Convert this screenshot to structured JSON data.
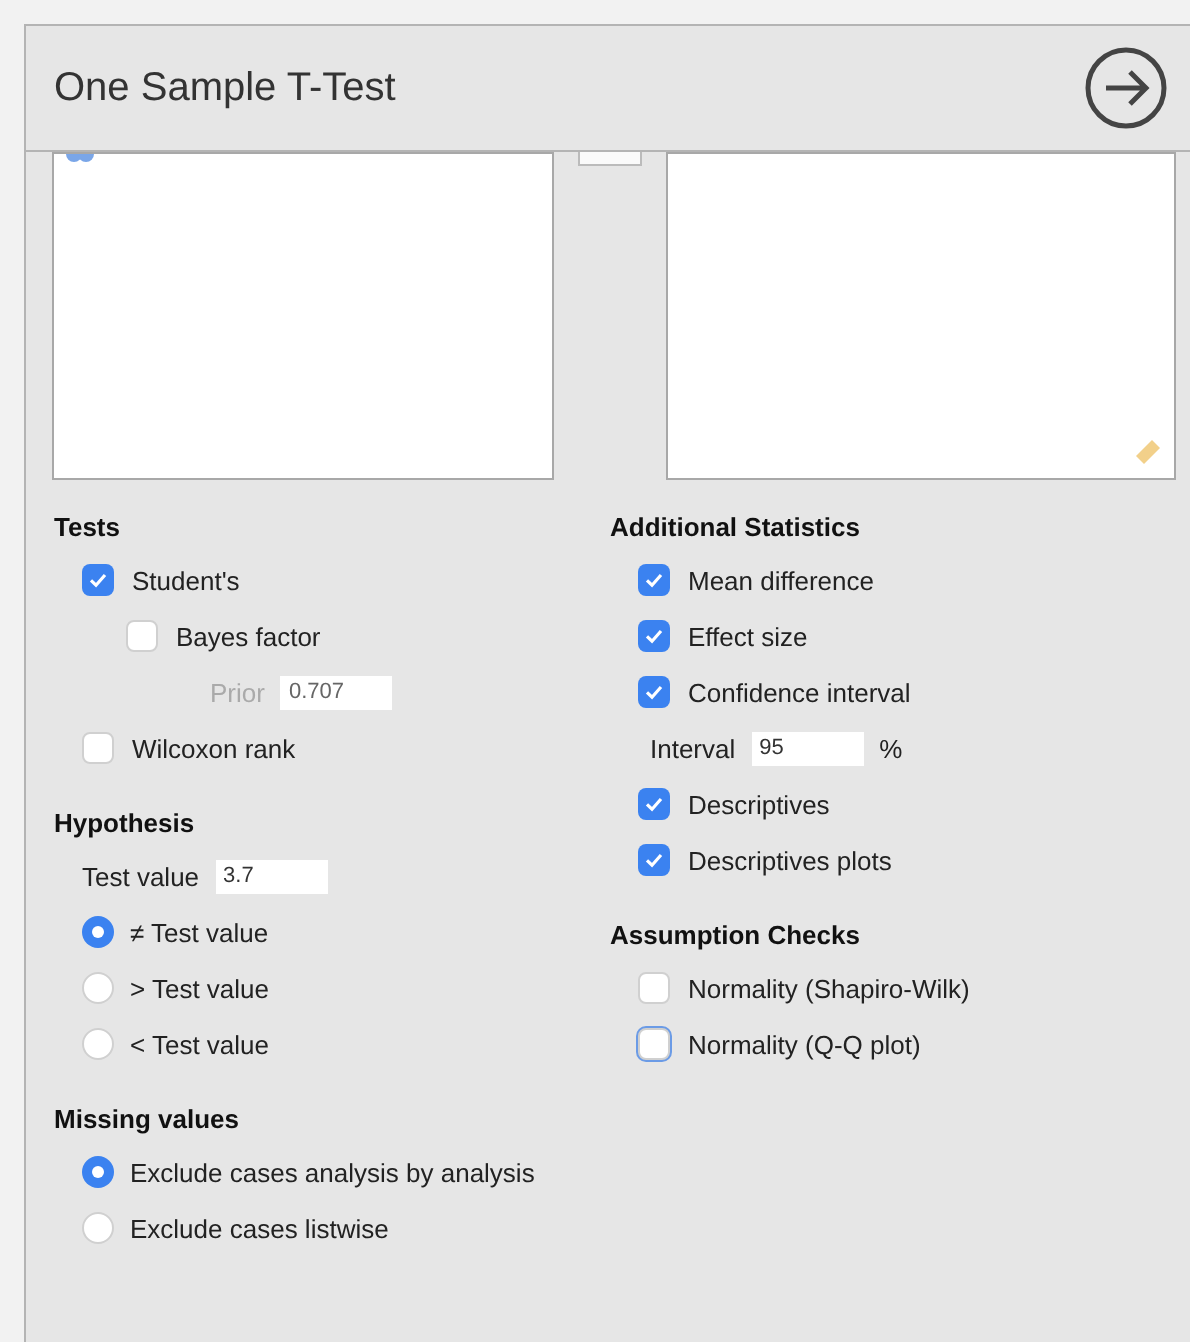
{
  "panel": {
    "title": "One Sample T-Test"
  },
  "left_column": [
    {
      "heading": "Tests",
      "items": [
        {
          "kind": "checkbox",
          "label": "Student's",
          "checked": true,
          "children": [
            {
              "kind": "checkbox",
              "label": "Bayes factor",
              "checked": false,
              "children": [
                {
                  "kind": "field",
                  "label": "Prior",
                  "value": "0.707",
                  "disabled": true
                }
              ]
            }
          ]
        },
        {
          "kind": "checkbox",
          "label": "Wilcoxon rank",
          "checked": false
        }
      ]
    },
    {
      "heading": "Hypothesis",
      "items": [
        {
          "kind": "field",
          "label": "Test value",
          "value": "3.7",
          "disabled": false
        },
        {
          "kind": "radio",
          "label": "≠ Test value",
          "selected": true
        },
        {
          "kind": "radio",
          "label": "> Test value",
          "selected": false
        },
        {
          "kind": "radio",
          "label": "< Test value",
          "selected": false
        }
      ]
    },
    {
      "heading": "Missing values",
      "items": [
        {
          "kind": "radio",
          "label": "Exclude cases analysis by analysis",
          "selected": true
        },
        {
          "kind": "radio",
          "label": "Exclude cases listwise",
          "selected": false
        }
      ]
    }
  ],
  "right_column": [
    {
      "heading": "Additional Statistics",
      "items": [
        {
          "kind": "checkbox",
          "label": "Mean difference",
          "checked": true
        },
        {
          "kind": "checkbox",
          "label": "Effect size",
          "checked": true
        },
        {
          "kind": "checkbox",
          "label": "Confidence interval",
          "checked": true,
          "children": [
            {
              "kind": "field",
              "label": "Interval",
              "value": "95",
              "unit": "%",
              "disabled": false
            }
          ]
        },
        {
          "kind": "checkbox",
          "label": "Descriptives",
          "checked": true
        },
        {
          "kind": "checkbox",
          "label": "Descriptives plots",
          "checked": true
        }
      ]
    },
    {
      "heading": "Assumption Checks",
      "items": [
        {
          "kind": "checkbox",
          "label": "Normality (Shapiro-Wilk)",
          "checked": false
        },
        {
          "kind": "checkbox",
          "label": "Normality (Q-Q plot)",
          "checked": false,
          "focused": true
        }
      ]
    }
  ]
}
